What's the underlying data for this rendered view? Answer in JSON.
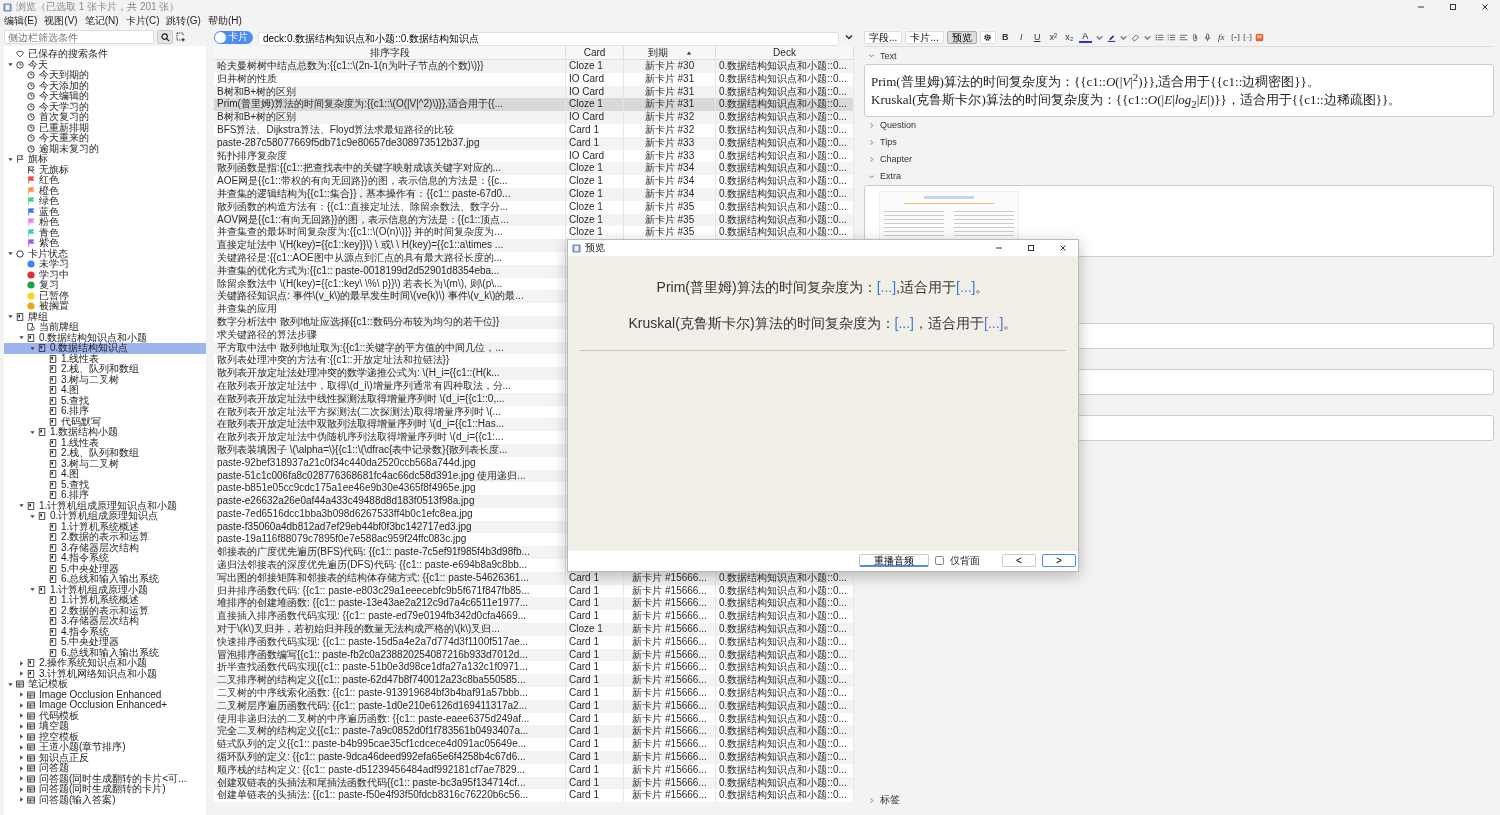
{
  "window": {
    "title": "浏览（已选取 1 张卡片，共 201 张）"
  },
  "menu": [
    "编辑(E)",
    "视图(V)",
    "笔记(N)",
    "卡片(C)",
    "跳转(G)",
    "帮助(H)"
  ],
  "sidebar": {
    "search": {
      "placeholder": "侧边栏筛选条件"
    },
    "items": [
      {
        "label": "已保存的搜索条件",
        "kind": "heart",
        "selected": false
      },
      {
        "label": "今天",
        "kind": "clock",
        "expanded": true,
        "selected": false,
        "children": [
          {
            "label": "今天到期的",
            "kind": "clock",
            "selected": false
          },
          {
            "label": "今天添加的",
            "kind": "clock",
            "selected": false
          },
          {
            "label": "今天编辑的",
            "kind": "clock",
            "selected": false
          },
          {
            "label": "今天学习的",
            "kind": "clock",
            "selected": false
          },
          {
            "label": "首次复习的",
            "kind": "clock",
            "selected": false
          },
          {
            "label": "已重新排期",
            "kind": "clock",
            "selected": false
          },
          {
            "label": "今天重来的",
            "kind": "clock",
            "selected": false
          },
          {
            "label": "逾期未复习的",
            "kind": "clock",
            "selected": false
          }
        ]
      },
      {
        "label": "旗标",
        "kind": "flag",
        "expanded": true,
        "selected": false,
        "children": [
          {
            "label": "无旗标",
            "kind": "noflag",
            "selected": false
          },
          {
            "label": "红色",
            "kind": "flag",
            "color": "#f04a4a",
            "selected": false
          },
          {
            "label": "橙色",
            "kind": "flag",
            "color": "#f5933a",
            "selected": false
          },
          {
            "label": "绿色",
            "kind": "flag",
            "color": "#4fd18b",
            "selected": false
          },
          {
            "label": "蓝色",
            "kind": "flag",
            "color": "#3a78f0",
            "selected": false
          },
          {
            "label": "粉色",
            "kind": "flag",
            "color": "#f07ff0",
            "selected": false
          },
          {
            "label": "青色",
            "kind": "flag",
            "color": "#39d1c0",
            "selected": false
          },
          {
            "label": "紫色",
            "kind": "flag",
            "color": "#9b5cf0",
            "selected": false
          }
        ]
      },
      {
        "label": "卡片状态",
        "kind": "circle",
        "expanded": true,
        "selected": false,
        "children": [
          {
            "label": "未学习",
            "kind": "dot",
            "color": "#3d85f5",
            "selected": false
          },
          {
            "label": "学习中",
            "kind": "dot",
            "color": "#e03131",
            "selected": false
          },
          {
            "label": "复习",
            "kind": "dot",
            "color": "#1fa34a",
            "selected": false
          },
          {
            "label": "已暂停",
            "kind": "dot",
            "color": "#ffd21f",
            "selected": false
          },
          {
            "label": "被搁置",
            "kind": "dot",
            "color": "#f5a20c",
            "selected": false
          }
        ]
      },
      {
        "label": "牌组",
        "kind": "deck",
        "expanded": true,
        "selected": false,
        "children": [
          {
            "label": "当前牌组",
            "kind": "current-deck",
            "selected": false
          },
          {
            "label": "0.数据结构知识点和小题",
            "kind": "deck",
            "expanded": true,
            "selected": false,
            "children": [
              {
                "label": "0.数据结构知识点",
                "kind": "deck",
                "expanded": true,
                "selected": true,
                "children": [
                  {
                    "label": "1.线性表",
                    "kind": "deck",
                    "selected": false
                  },
                  {
                    "label": "2.栈、队列和数组",
                    "kind": "deck",
                    "selected": false
                  },
                  {
                    "label": "3.树与二叉树",
                    "kind": "deck",
                    "selected": false
                  },
                  {
                    "label": "4.图",
                    "kind": "deck",
                    "selected": false
                  },
                  {
                    "label": "5.查找",
                    "kind": "deck",
                    "selected": false
                  },
                  {
                    "label": "6.排序",
                    "kind": "deck",
                    "selected": false
                  },
                  {
                    "label": "代码默写",
                    "kind": "deck",
                    "selected": false
                  }
                ]
              },
              {
                "label": "1.数据结构小题",
                "kind": "deck",
                "expanded": true,
                "selected": false,
                "children": [
                  {
                    "label": "1.线性表",
                    "kind": "deck",
                    "selected": false
                  },
                  {
                    "label": "2.栈、队列和数组",
                    "kind": "deck",
                    "selected": false
                  },
                  {
                    "label": "3.树与二叉树",
                    "kind": "deck",
                    "selected": false
                  },
                  {
                    "label": "4.图",
                    "kind": "deck",
                    "selected": false
                  },
                  {
                    "label": "5.查找",
                    "kind": "deck",
                    "selected": false
                  },
                  {
                    "label": "6.排序",
                    "kind": "deck",
                    "selected": false
                  }
                ]
              }
            ]
          },
          {
            "label": "1.计算机组成原理知识点和小题",
            "kind": "deck",
            "expanded": true,
            "selected": false,
            "children": [
              {
                "label": "0.计算机组成原理知识点",
                "kind": "deck",
                "expanded": true,
                "selected": false,
                "children": [
                  {
                    "label": "1.计算机系统概述",
                    "kind": "deck",
                    "selected": false
                  },
                  {
                    "label": "2.数据的表示和运算",
                    "kind": "deck",
                    "selected": false
                  },
                  {
                    "label": "3.存储器层次结构",
                    "kind": "deck",
                    "selected": false
                  },
                  {
                    "label": "4.指令系统",
                    "kind": "deck",
                    "selected": false
                  },
                  {
                    "label": "5.中央处理器",
                    "kind": "deck",
                    "selected": false
                  },
                  {
                    "label": "6.总线和输入输出系统",
                    "kind": "deck",
                    "selected": false
                  }
                ]
              },
              {
                "label": "1.计算机组成原理小题",
                "kind": "deck",
                "expanded": true,
                "selected": false,
                "children": [
                  {
                    "label": "1.计算机系统概述",
                    "kind": "deck",
                    "selected": false
                  },
                  {
                    "label": "2.数据的表示和运算",
                    "kind": "deck",
                    "selected": false
                  },
                  {
                    "label": "3.存储器层次结构",
                    "kind": "deck",
                    "selected": false
                  },
                  {
                    "label": "4.指令系统",
                    "kind": "deck",
                    "selected": false
                  },
                  {
                    "label": "5.中央处理器",
                    "kind": "deck",
                    "selected": false
                  },
                  {
                    "label": "6.总线和输入输出系统",
                    "kind": "deck",
                    "selected": false
                  }
                ]
              }
            ]
          },
          {
            "label": "2.操作系统知识点和小题",
            "kind": "deck",
            "expanded": false,
            "selected": false
          },
          {
            "label": "3.计算机网络知识点和小题",
            "kind": "deck",
            "expanded": false,
            "selected": false
          }
        ]
      },
      {
        "label": "笔记模板",
        "kind": "notetype",
        "expanded": true,
        "selected": false,
        "children": [
          {
            "label": "Image Occlusion Enhanced",
            "kind": "notetype",
            "expanded": false,
            "selected": false
          },
          {
            "label": "Image Occlusion Enhanced+",
            "kind": "notetype",
            "expanded": false,
            "selected": false
          },
          {
            "label": "代码模板",
            "kind": "notetype",
            "expanded": false,
            "selected": false
          },
          {
            "label": "填空题",
            "kind": "notetype",
            "expanded": false,
            "selected": false
          },
          {
            "label": "挖空模板",
            "kind": "notetype",
            "expanded": false,
            "selected": false
          },
          {
            "label": "王道小题(章节排序)",
            "kind": "notetype",
            "expanded": false,
            "selected": false
          },
          {
            "label": "知识点正反",
            "kind": "notetype",
            "expanded": false,
            "selected": false
          },
          {
            "label": "问答题",
            "kind": "notetype",
            "expanded": false,
            "selected": false
          },
          {
            "label": "问答题(同时生成翻转的卡片<可...",
            "kind": "notetype",
            "expanded": false,
            "selected": false
          },
          {
            "label": "问答题(同时生成翻转的卡片)",
            "kind": "notetype",
            "expanded": false,
            "selected": false
          },
          {
            "label": "问答题(输入答案)",
            "kind": "notetype",
            "expanded": false,
            "selected": false
          }
        ]
      }
    ]
  },
  "toggle": {
    "label": "卡片",
    "on": true
  },
  "search": {
    "value": "deck:0.数据结构知识点和小题::0.数据结构知识点"
  },
  "table": {
    "columns": [
      {
        "label": "排序字段",
        "sorted": false
      },
      {
        "label": "Card",
        "sorted": false
      },
      {
        "label": "到期",
        "sorted": true
      },
      {
        "label": "Deck",
        "sorted": false
      }
    ],
    "rows": [
      {
        "sort_field": "哈夫曼树树中结点总数为:{{c1::\\(2n-1(n为叶子节点的个数)\\)}}",
        "card": "Cloze 1",
        "due": "新卡片 #30",
        "deck": "0.数据结构知识点和小题::0...",
        "selected": false
      },
      {
        "sort_field": "归并树的性质",
        "card": "IO Card",
        "due": "新卡片 #31",
        "deck": "0.数据结构知识点和小题::0...",
        "selected": false
      },
      {
        "sort_field": "B树和B+树的区别",
        "card": "IO Card",
        "due": "新卡片 #31",
        "deck": "0.数据结构知识点和小题::0...",
        "selected": false
      },
      {
        "sort_field": "Prim(普里姆)算法的时间复杂度为:{{c1::\\(O(|V|^2)\\)}},适合用于{{...",
        "card": "Cloze 1",
        "due": "新卡片 #31",
        "deck": "0.数据结构知识点和小题::0...",
        "selected": true
      },
      {
        "sort_field": "B树和B+树的区别",
        "card": "IO Card",
        "due": "新卡片 #32",
        "deck": "0.数据结构知识点和小题::0...",
        "selected": false
      },
      {
        "sort_field": "BFS算法、Dijkstra算法、Floyd算法求最短路径的比较",
        "card": "Card 1",
        "due": "新卡片 #32",
        "deck": "0.数据结构知识点和小题::0...",
        "selected": false
      },
      {
        "sort_field": "paste-287c58077669f5db71c9e80657de308973512b37.jpg",
        "card": "Card 1",
        "due": "新卡片 #33",
        "deck": "0.数据结构知识点和小题::0...",
        "selected": false
      },
      {
        "sort_field": "拓扑排序复杂度",
        "card": "IO Card",
        "due": "新卡片 #33",
        "deck": "0.数据结构知识点和小题::0...",
        "selected": false
      },
      {
        "sort_field": "散列函数是指:{{c1::把查找表中的关键字映射成该关键字对应的...",
        "card": "Cloze 1",
        "due": "新卡片 #34",
        "deck": "0.数据结构知识点和小题::0...",
        "selected": false
      },
      {
        "sort_field": "AOE网是{{c1::带权的有向无回路}}的图，表示信息的方法是：{{c...",
        "card": "Cloze 1",
        "due": "新卡片 #34",
        "deck": "0.数据结构知识点和小题::0...",
        "selected": false
      },
      {
        "sort_field": "并查集的逻辑结构为{{c1::集合}}，基本操作有：{{c1:: paste-67d0...",
        "card": "Cloze 1",
        "due": "新卡片 #34",
        "deck": "0.数据结构知识点和小题::0...",
        "selected": false
      },
      {
        "sort_field": "散列函数的构造方法有：{{c1::直接定址法、除留余数法、数字分...",
        "card": "Cloze 1",
        "due": "新卡片 #35",
        "deck": "0.数据结构知识点和小题::0...",
        "selected": false
      },
      {
        "sort_field": "AOV网是{{c1::有向无回路}}的图，表示信息的方法是：{{c1::顶点...",
        "card": "Cloze 1",
        "due": "新卡片 #35",
        "deck": "0.数据结构知识点和小题::0...",
        "selected": false
      },
      {
        "sort_field": "并查集查的最坏时间复杂度为:{{c1::\\(O(n)\\)}} 并的时间复杂度为...",
        "card": "Cloze 1",
        "due": "新卡片 #35",
        "deck": "0.数据结构知识点和小题::0...",
        "selected": false
      },
      {
        "sort_field": "直接定址法中 \\(H(key)={{c1::key}}\\) \\ 或\\ \\ H(key)={{c1::a\\times ...",
        "selected": false
      },
      {
        "sort_field": "关键路径是:{{c1::AOE图中从源点到汇点的具有最大路径长度的...",
        "selected": false
      },
      {
        "sort_field": "并查集的优化方式为:{{c1:: paste-0018199d2d52901d8354eba...",
        "selected": false
      },
      {
        "sort_field": "除留余数法中 \\(H(key)={{c1::key\\ \\%\\ p}}\\) 若表长为\\(m\\), 则\\(p\\...",
        "selected": false
      },
      {
        "sort_field": "关键路径知识点: 事件\\(v_k\\)的最早发生时间\\(ve(k)\\) 事件\\(v_k\\)的最...",
        "selected": false
      },
      {
        "sort_field": "并查集的应用",
        "selected": false
      },
      {
        "sort_field": "数字分析法中 散列地址应选择{{c1::数码分布较为均匀的若干位}}",
        "selected": false
      },
      {
        "sort_field": "求关键路径的算法步骤",
        "selected": false
      },
      {
        "sort_field": "平方取中法中 散列地址取为:{{c1::关键字的平方值的中间几位，...",
        "selected": false
      },
      {
        "sort_field": "散列表处理冲突的方法有:{{c1::开放定址法和拉链法}}",
        "selected": false
      },
      {
        "sort_field": "散列表开放定址法处理冲突的数学递推公式为: \\(H_i={{c1::(H(k...",
        "selected": false
      },
      {
        "sort_field": "在散列表开放定址法中，取得\\(d_i\\)增量序列通常有四种取法，分...",
        "selected": false
      },
      {
        "sort_field": "在散列表开放定址法中线性探测法取得增量序列时 \\(d_i={{c1::0,...",
        "selected": false
      },
      {
        "sort_field": "在散列表开放定址法平方探测法(二次探测法)取得增量序列时 \\(...",
        "selected": false
      },
      {
        "sort_field": "在散列表开放定址法中双散列法取得增量序列时 \\(d_i={{c1::Has...",
        "selected": false
      },
      {
        "sort_field": "在散列表开放定址法中伪随机序列法取得增量序列时 \\(d_i={{c1:...",
        "selected": false
      },
      {
        "sort_field": "散列表装填因子 \\(\\alpha=\\){{c1::\\(\\dfrac{表中记录数}{散列表长度...",
        "selected": false
      },
      {
        "sort_field": "paste-92bef318937a21c0f34c440da2520ccb568a744d.jpg",
        "selected": false
      },
      {
        "sort_field": "paste-51c1c006fa8c028776368681fc4ac66dc58d391e.jpg 使用递归...",
        "selected": false
      },
      {
        "sort_field": "paste-b851e05cc9cdc175a1ee46e9b30e4365f8f4965e.jpg",
        "selected": false
      },
      {
        "sort_field": "paste-e26632a26e0af44a433c49488d8d183f0513f98a.jpg",
        "selected": false
      },
      {
        "sort_field": "paste-7ed6516dcc1bba3b098d6267533ff4b0c1efc8ea.jpg",
        "selected": false
      },
      {
        "sort_field": "paste-f35060a4db812ad7ef29eb44bf0f3bc142717ed3.jpg",
        "selected": false
      },
      {
        "sort_field": "paste-19a116f88079c7895f0e7e588ac959f24ffc083c.jpg",
        "selected": false
      },
      {
        "sort_field": "邻接表的广度优先遍历(BFS)代码: {{c1:: paste-7c5ef91f985f4b3d98fb...",
        "selected": false
      },
      {
        "sort_field": "递归法邻接表的深度优先遍历(DFS)代码: {{c1:: paste-e694b8a9c8bb...",
        "selected": false
      },
      {
        "sort_field": "写出图的邻接矩阵和邻接表的结构体存储方式: {{c1:: paste-54626361...",
        "card": "Card 1",
        "due": "新卡片 #15666...",
        "deck": "0.数据结构知识点和小题::0...",
        "selected": false
      },
      {
        "sort_field": "归并排序函数代码: {{c1:: paste-e803c29a1eeecebfc9b5f671f847fb85...",
        "card": "Card 1",
        "due": "新卡片 #15666...",
        "deck": "0.数据结构知识点和小题::0...",
        "selected": false
      },
      {
        "sort_field": "堆排序的创建堆函数: {{c1:: paste-13e43ae2a212c9d7a4c6511e1977...",
        "card": "Card 1",
        "due": "新卡片 #15666...",
        "deck": "0.数据结构知识点和小题::0...",
        "selected": false
      },
      {
        "sort_field": "直接插入排序函数代码实现: {{c1:: paste-ed79e0194fb342d0cfa4669...",
        "card": "Card 1",
        "due": "新卡片 #15666...",
        "deck": "0.数据结构知识点和小题::0...",
        "selected": false
      },
      {
        "sort_field": "对于\\(k\\)叉归并，若初始归并段的数量无法构成严格的\\(k\\)叉归...",
        "card": "Cloze 1",
        "due": "新卡片 #15666...",
        "deck": "0.数据结构知识点和小题::0...",
        "selected": false
      },
      {
        "sort_field": "快速排序函数代码实现: {{c1:: paste-15d5a4e2a7d774d3f1100f517ae...",
        "card": "Card 1",
        "due": "新卡片 #15666...",
        "deck": "0.数据结构知识点和小题::0...",
        "selected": false
      },
      {
        "sort_field": "冒泡排序函数编写{{c1:: paste-fb2c0a238820254087216b933d7012d...",
        "card": "Card 1",
        "due": "新卡片 #15666...",
        "deck": "0.数据结构知识点和小题::0...",
        "selected": false
      },
      {
        "sort_field": "折半查找函数代码实现{{c1:: paste-51b0e3d98ce1dfa27a132c1f0971...",
        "card": "Card 1",
        "due": "新卡片 #15666...",
        "deck": "0.数据结构知识点和小题::0...",
        "selected": false
      },
      {
        "sort_field": "二叉排序树的结构定义{{c1:: paste-62d47b8f740012a23c8ba550585...",
        "card": "Card 1",
        "due": "新卡片 #15666...",
        "deck": "0.数据结构知识点和小题::0...",
        "selected": false
      },
      {
        "sort_field": "二叉树的中序线索化函数: {{c1:: paste-913919684bf3b4baf91a57bbb...",
        "card": "Card 1",
        "due": "新卡片 #15666...",
        "deck": "0.数据结构知识点和小题::0...",
        "selected": false
      },
      {
        "sort_field": "二叉树层序遍历函数代码: {{c1:: paste-1d0e210e6126d169411317a2...",
        "card": "Card 1",
        "due": "新卡片 #15666...",
        "deck": "0.数据结构知识点和小题::0...",
        "selected": false
      },
      {
        "sort_field": "使用非递归法的二叉树的中序遍历函数: {{c1:: paste-eaee6375d249af...",
        "card": "Card 1",
        "due": "新卡片 #15666...",
        "deck": "0.数据结构知识点和小题::0...",
        "selected": false
      },
      {
        "sort_field": "完全二叉树的结构定义{{c1:: paste-7a9c0852d0f1f783561b0493407a...",
        "card": "Card 1",
        "due": "新卡片 #15666...",
        "deck": "0.数据结构知识点和小题::0...",
        "selected": false
      },
      {
        "sort_field": "链式队列的定义{{c1:: paste-b4b995cae35cf1cdcece4d091ac05649e...",
        "card": "Card 1",
        "due": "新卡片 #15666...",
        "deck": "0.数据结构知识点和小题::0...",
        "selected": false
      },
      {
        "sort_field": "循环队列的定义: {{c1:: paste-9dca46deed992efa65e6f4258b4c67d6...",
        "card": "Card 1",
        "due": "新卡片 #15666...",
        "deck": "0.数据结构知识点和小题::0...",
        "selected": false
      },
      {
        "sort_field": "顺序栈的结构定义: {{c1:: paste-d51239456484adf992181cf7ae7829...",
        "card": "Card 1",
        "due": "新卡片 #15666...",
        "deck": "0.数据结构知识点和小题::0...",
        "selected": false
      },
      {
        "sort_field": "创建双链表的头插法和尾插法函数代码{{c1:: paste-bc3a95f134714cf...",
        "card": "Card 1",
        "due": "新卡片 #15666...",
        "deck": "0.数据结构知识点和小题::0...",
        "selected": false
      },
      {
        "sort_field": "创建单链表的头插法: {{c1:: paste-f50e4f93f50fdcb8316c76220b6c56...",
        "card": "Card 1",
        "due": "新卡片 #15666...",
        "deck": "0.数据结构知识点和小题::0...",
        "selected": false
      }
    ]
  },
  "editor": {
    "buttons": [
      {
        "label": "字段...",
        "selected": false
      },
      {
        "label": "卡片...",
        "selected": false
      },
      {
        "label": "预览",
        "selected": true
      }
    ],
    "format_buttons": [
      "B",
      "I",
      "U",
      "x²",
      "x₂"
    ],
    "color_button": "A",
    "formula_button": "fx",
    "fields": [
      {
        "label": "Text",
        "kind": "text",
        "expanded": true,
        "lines": [
          "Prim(普里姆)算法的时间复杂度为：{{c1::*O*(|*V*|$^{2}$)}},适合用于{{c1::边稠密图}}。",
          "Kruskal(克鲁斯卡尔)算法的时间复杂度为：{{c1::*O*(|*E*|*log*$_{2}$|*E*|)}}，适合用于{{c1::边稀疏图}}。"
        ]
      },
      {
        "label": "Question",
        "expanded": false
      },
      {
        "label": "Tips",
        "expanded": false
      },
      {
        "label": "Chapter",
        "expanded": false
      },
      {
        "label": "Extra",
        "kind": "image",
        "expanded": true
      }
    ],
    "more_fields": [
      {
        "expanded": true
      },
      {
        "expanded": true
      },
      {
        "expanded": true
      }
    ],
    "tags_label": "标签"
  },
  "dialog": {
    "title": "预览",
    "lines": [
      [
        {
          "text": "Prim(普里姆)算法的时间复杂度为：",
          "cloze": false
        },
        {
          "text": "[...]",
          "cloze": true
        },
        {
          "text": ",适合用于",
          "cloze": false
        },
        {
          "text": "[...]",
          "cloze": true
        },
        {
          "text": "。",
          "cloze": false
        }
      ],
      [
        {
          "text": "Kruskal(克鲁斯卡尔)算法的时间复杂度为：",
          "cloze": false
        },
        {
          "text": "[...]",
          "cloze": true
        },
        {
          "text": "，适合用于",
          "cloze": false
        },
        {
          "text": "[...]",
          "cloze": true
        },
        {
          "text": "。",
          "cloze": false
        }
      ]
    ],
    "replay_button": "重播音频",
    "back_only": {
      "label": "仅背面",
      "checked": false
    },
    "nav": [
      {
        "label": "<",
        "focused": false
      },
      {
        "label": ">",
        "focused": true
      }
    ]
  }
}
